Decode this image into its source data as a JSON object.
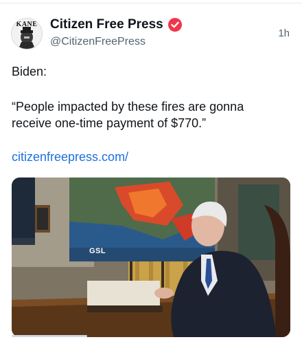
{
  "account": {
    "display_name": "Citizen Free Press",
    "handle": "@CitizenFreePress",
    "avatar_text": "KANE",
    "verified": true,
    "badge_color": "#f0364a"
  },
  "post": {
    "time": "1h",
    "line1": "Biden:",
    "quote": "“People impacted by these fires are gonna receive one-time payment of $770.”",
    "link": "citizenfreepress.com/",
    "link_color": "#1d6fdd"
  },
  "media": {
    "logo_text": "GSL"
  }
}
